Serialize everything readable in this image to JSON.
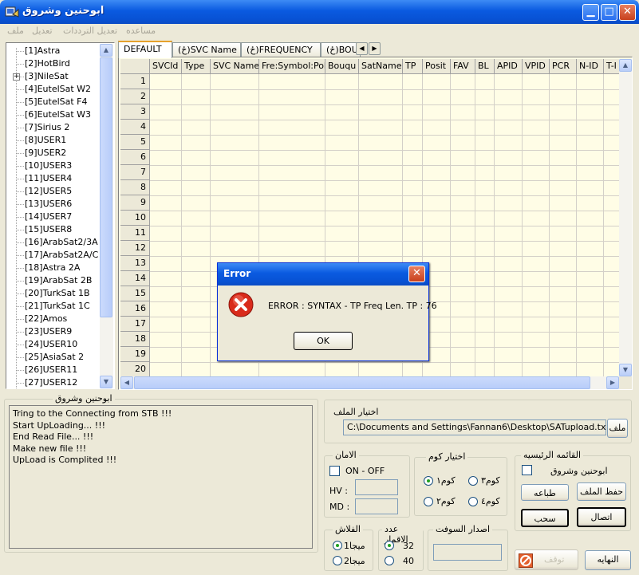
{
  "window": {
    "title": "ابوحنين وشروق"
  },
  "menu": [
    "ملف",
    "تعديل",
    "تعديل الترددات",
    "مساعده"
  ],
  "tree": {
    "items": [
      "[1]Astra",
      "[2]HotBird",
      "[3]NileSat",
      "[4]EutelSat W2",
      "[5]EutelSat F4",
      "[6]EutelSat W3",
      "[7]Sirius 2",
      "[8]USER1",
      "[9]USER2",
      "[10]USER3",
      "[11]USER4",
      "[12]USER5",
      "[13]USER6",
      "[14]USER7",
      "[15]USER8",
      "[16]ArabSat2/3A",
      "[17]ArabSat2A/C",
      "[18]Astra 2A",
      "[19]ArabSat 2B",
      "[20]TurkSat 1B",
      "[21]TurkSat 1C",
      "[22]Amos",
      "[23]USER9",
      "[24]USER10",
      "[25]AsiaSat 2",
      "[26]USER11",
      "[27]USER12"
    ],
    "expander": "+"
  },
  "tabs": [
    "DEFAULT",
    "(ځ)SVC Name",
    "(ځ)FREQUENCY",
    "(ځ)BOU"
  ],
  "grid": {
    "columns": [
      "SVCId",
      "Type",
      "SVC Name",
      "Fre:Symbol:Pol",
      "Bouqu",
      "SatName",
      "TP",
      "Posit",
      "FAV",
      "BL",
      "APID",
      "VPID",
      "PCR",
      "N-ID",
      "T-I"
    ],
    "rows": [
      "1",
      "2",
      "3",
      "4",
      "5",
      "6",
      "7",
      "8",
      "9",
      "10",
      "11",
      "12",
      "13",
      "14",
      "15",
      "16",
      "17",
      "18",
      "19",
      "20"
    ]
  },
  "log": {
    "title": "ابوحنين وشروق",
    "lines": [
      "Tring to the Connecting from STB !!!",
      "Start UpLoading... !!!",
      "End Read File... !!!",
      "Make new file !!!",
      "UpLoad is Complited !!!"
    ]
  },
  "file": {
    "group_title": "اختيار الملف",
    "path": "C:\\Documents and Settings\\Fannan6\\Desktop\\SATupload.txt",
    "button": "ملف"
  },
  "security": {
    "title": "الامان",
    "checkbox": "ON - OFF",
    "hv_label": "HV :",
    "md_label": "MD :"
  },
  "com": {
    "title": "اختيار كوم",
    "com1": "كوم١",
    "com2": "كوم٢",
    "com3": "كوم٣",
    "com4": "كوم٤"
  },
  "main_list": {
    "title": "القائمه الرئيسيه",
    "checkbox": "ابوحنين وشروق",
    "save": "حفظ الملف",
    "print": "طباعه",
    "connect": "اتصال",
    "pull": "سحب"
  },
  "flash": {
    "title": "الفلاش",
    "mb1": "1ميجا",
    "mb2": "2ميجا"
  },
  "sats": {
    "title": "عدد الاقمار",
    "v32": "32",
    "v40": "40"
  },
  "software": {
    "title": "اصدار السوفت"
  },
  "bottom": {
    "stop": "توقف",
    "end": "النهايه"
  },
  "dialog": {
    "title": "Error",
    "message": "ERROR : SYNTAX - TP Freq Len. TP : 76",
    "ok": "OK"
  }
}
